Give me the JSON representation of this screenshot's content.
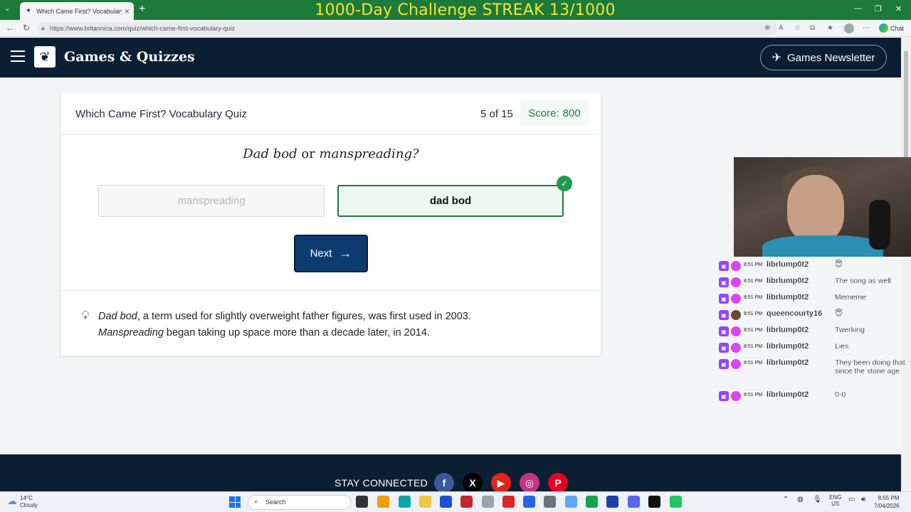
{
  "browser": {
    "tab_title": "Which Came First? Vocabulary Qui",
    "url": "https://www.britannica.com/quiz/which-came-first-vocabulary-quiz",
    "chat_label": "Chat"
  },
  "overlay": {
    "title": "1000-Day Challenge STREAK 13/1000"
  },
  "header": {
    "brand": "Games & Quizzes",
    "newsletter_label": "Games Newsletter"
  },
  "quiz": {
    "title": "Which Came First? Vocabulary Quiz",
    "progress": "5 of 15",
    "score_label": "Score:",
    "score_value": "800",
    "question": {
      "option_a_text": "Dad bod",
      "or": "or",
      "option_b_text": "manspreading?"
    },
    "options": [
      {
        "label": "manspreading",
        "state": "disabled"
      },
      {
        "label": "dad bod",
        "state": "correct"
      }
    ],
    "next_label": "Next",
    "explanation": {
      "term1": "Dad bod",
      "part1": ", a term used for slightly overweight father figures, was first used in 2003.",
      "term2": "Manspreading",
      "part2": " began taking up space more than a decade later, in 2014."
    }
  },
  "footer": {
    "stay_connected": "STAY CONNECTED",
    "social": [
      {
        "icon": "facebook-icon",
        "glyph": "f",
        "color": "#3b5998"
      },
      {
        "icon": "x-icon",
        "glyph": "X",
        "color": "#000000"
      },
      {
        "icon": "youtube-icon",
        "glyph": "▶",
        "color": "#e62117"
      },
      {
        "icon": "instagram-icon",
        "glyph": "◎",
        "color": "#c13584"
      },
      {
        "icon": "pinterest-icon",
        "glyph": "P",
        "color": "#e60023"
      }
    ]
  },
  "chat": {
    "messages": [
      {
        "time": "8:51 PM",
        "user": "librlump0t2",
        "message": "😇"
      },
      {
        "time": "8:51 PM",
        "user": "librlump0t2",
        "message": "The song as well"
      },
      {
        "time": "8:51 PM",
        "user": "librlump0t2",
        "message": "Mememe"
      },
      {
        "time": "8:51 PM",
        "user": "queencourty16",
        "message": "😇"
      },
      {
        "time": "8:51 PM",
        "user": "librlump0t2",
        "message": "Twerking"
      },
      {
        "time": "8:51 PM",
        "user": "librlump0t2",
        "message": "Lies"
      },
      {
        "time": "8:51 PM",
        "user": "librlump0t2",
        "message": "They been doing that since the stone age"
      },
      {
        "time": "8:51 PM",
        "user": "librlump0t2",
        "message": "0-0"
      }
    ]
  },
  "taskbar": {
    "temperature": "14°C",
    "weather": "Cloudy",
    "search_placeholder": "Search",
    "lang1": "ENG",
    "lang2": "US",
    "time": "8:55 PM",
    "date": "7/04/2026"
  },
  "colors": {
    "header_bg": "#0b1f33",
    "correct_green": "#1f7a3d",
    "next_button": "#0b3b6f",
    "overlay_text": "#f5e533"
  }
}
